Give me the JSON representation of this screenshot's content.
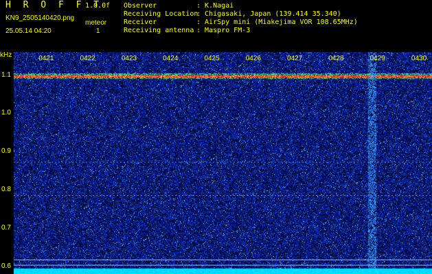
{
  "header": {
    "app_title": "H R O F F T",
    "version": "1.0.0f",
    "filename": "KN9_2505140420.png",
    "datetime": "25.05.14 04:20",
    "meteor_label": "meteor",
    "meteor_count": "1",
    "observer_label": "Observer",
    "observer_value": ": K.Nagai",
    "location_label": "Receiving Location",
    "location_value": ": Chigasaki, Japan (139.414 35.340)",
    "receiver_label": "Receiver",
    "receiver_value": ": AirSpy mini (Miakejima VOR 108.65MHz)",
    "antenna_label": "Receiving antenna",
    "antenna_value": ": Maspro FM-3"
  },
  "spectrogram": {
    "y_unit": "kHz",
    "y_ticks": [
      "1.1",
      "1.0",
      "0.9",
      "0.8",
      "0.7",
      "0.6"
    ],
    "y_tick_values": [
      1.1,
      1.0,
      0.9,
      0.8,
      0.7,
      0.6
    ],
    "y_range": [
      0.58,
      1.16
    ],
    "x_ticks": [
      "0421",
      "0422",
      "0423",
      "0424",
      "0425",
      "0426",
      "0427",
      "0428",
      "0429",
      "0430"
    ],
    "x_tick_minutes": [
      21,
      22,
      23,
      24,
      25,
      26,
      27,
      28,
      29,
      30
    ],
    "x_range_minutes": [
      20.2,
      30.3
    ],
    "carrier_khz": 1.098,
    "meteor_minute": 28.85,
    "colors": {
      "text": "#ffff00",
      "background": "#000a3a",
      "noise": "#2244cc",
      "carrier": "#ff3030",
      "floor": "#00e5ff"
    }
  }
}
